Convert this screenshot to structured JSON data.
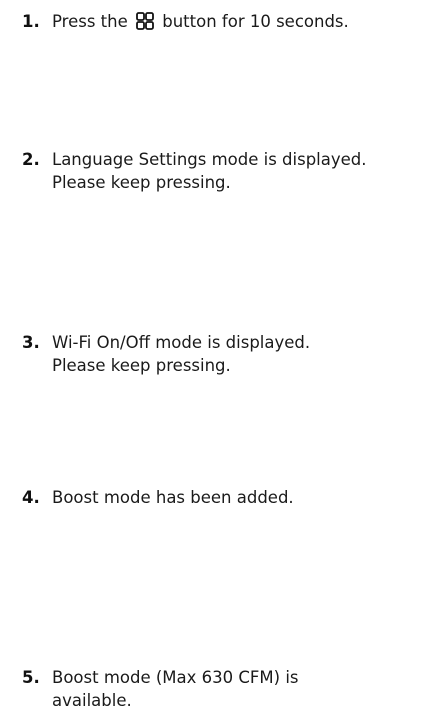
{
  "steps": [
    {
      "number": "1.",
      "before_icon": "Press the",
      "icon": "grid-icon",
      "after_icon": "button for 10 seconds."
    },
    {
      "number": "2.",
      "line1": "Language Settings mode is displayed.",
      "line2": "Please keep pressing."
    },
    {
      "number": "3.",
      "line1": "Wi-Fi On/Off mode is displayed.",
      "line2": "Please keep pressing."
    },
    {
      "number": "4.",
      "line1": "Boost mode has been added."
    },
    {
      "number": "5.",
      "line1": "Boost mode (Max 630 CFM) is",
      "line2": "available."
    }
  ]
}
